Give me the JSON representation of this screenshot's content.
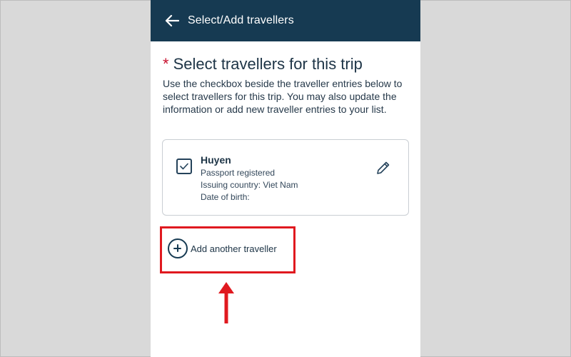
{
  "header": {
    "title": "Select/Add travellers",
    "back_icon": "arrow-left-icon",
    "background": "#163a52"
  },
  "section": {
    "required_marker": "*",
    "title": "Select travellers for this trip",
    "description": "Use the checkbox beside the traveller entries below to select travellers for this trip. You may also update the information or add new traveller entries to your list."
  },
  "travellers": [
    {
      "name": "Huyen",
      "passport_status": "Passport registered",
      "issuing_country": "Issuing country: Viet Nam",
      "date_of_birth": "Date of birth:",
      "selected": true,
      "edit_icon": "pencil-icon"
    }
  ],
  "add_traveller": {
    "label": "Add another traveller",
    "icon": "plus-circle-icon"
  },
  "annotation": {
    "highlight_color": "#e0191f",
    "arrow_icon": "arrow-up-icon"
  }
}
